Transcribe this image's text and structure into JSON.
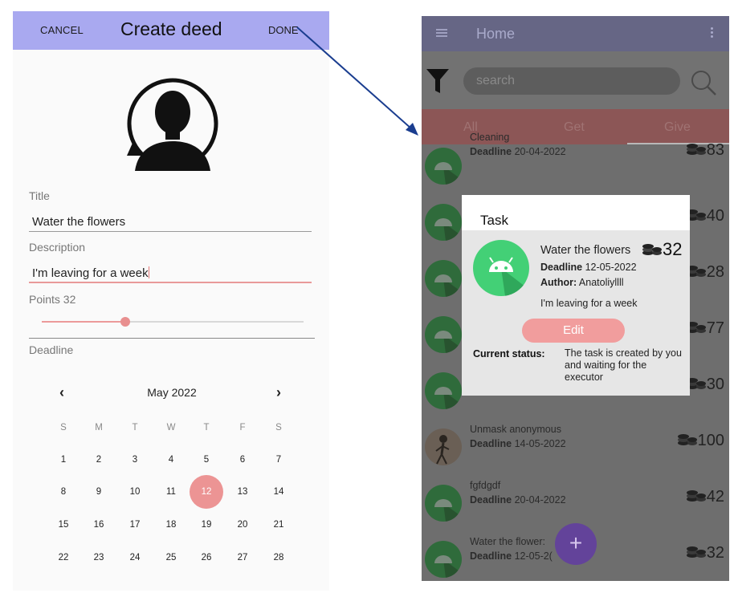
{
  "left": {
    "topbar": {
      "cancel_label": "CANCEL",
      "title": "Create deed",
      "done_label": "DONE"
    },
    "form": {
      "title_label": "Title",
      "title_value": "Water the flowers",
      "description_label": "Description",
      "description_value": "I'm leaving for a week",
      "points_label": "Points  32",
      "points_value": 32,
      "points_fraction": 0.32,
      "deadline_label": "Deadline"
    },
    "calendar": {
      "prev_icon": "‹",
      "next_icon": "›",
      "month_label": "May 2022",
      "weekdays": [
        "S",
        "M",
        "T",
        "W",
        "T",
        "F",
        "S"
      ],
      "weeks": [
        [
          "1",
          "2",
          "3",
          "4",
          "5",
          "6",
          "7"
        ],
        [
          "8",
          "9",
          "10",
          "11",
          "12",
          "13",
          "14"
        ],
        [
          "15",
          "16",
          "17",
          "18",
          "19",
          "20",
          "21"
        ],
        [
          "22",
          "23",
          "24",
          "25",
          "26",
          "27",
          "28"
        ]
      ],
      "selected_day": "12",
      "selected_color": "#ec9494"
    }
  },
  "right": {
    "appbar": {
      "title": "Home",
      "menu_icon": "hamburger-menu-icon",
      "more_icon": "more-vert-icon"
    },
    "search": {
      "placeholder": "search",
      "filter_icon": "filter-icon",
      "search_icon": "search-icon"
    },
    "tabs": [
      "All",
      "Get",
      "Give"
    ],
    "active_tab": "Give",
    "deadline_word": "Deadline",
    "rows": [
      {
        "title": "Cleaning",
        "deadline": "20-04-2022",
        "points": "83"
      },
      {
        "title": "",
        "deadline": "",
        "points": "40"
      },
      {
        "title": "",
        "deadline": "",
        "points": "28"
      },
      {
        "title": "",
        "deadline": "",
        "points": "77"
      },
      {
        "title": "",
        "deadline": "",
        "points": "30"
      },
      {
        "title": "Unmask anonymous",
        "deadline": "14-05-2022",
        "points": "100"
      },
      {
        "title": "fgfdgdf",
        "deadline": "20-04-2022",
        "points": "42"
      },
      {
        "title": "Water the flower:",
        "deadline": "12-05-2(",
        "points": "32"
      }
    ],
    "fab_label": "+",
    "dialog": {
      "title": "Task",
      "task_title": "Water the flowers",
      "points": "32",
      "deadline_label": "Deadline",
      "deadline": "12-05-2022",
      "author_label": "Author:",
      "author": "Anatoliyllll",
      "description": "I'm leaving for a week",
      "edit_label": "Edit",
      "status_label": "Current status:",
      "status_value": "The task is created by you and waiting for the executor"
    }
  },
  "colors": {
    "left_topbar": "#a9a9f0",
    "accent_pink": "#ec9494",
    "dialog_avatar_green": "#43d076",
    "fab_purple": "#63439a",
    "arrow_blue": "#1a3d8f"
  }
}
